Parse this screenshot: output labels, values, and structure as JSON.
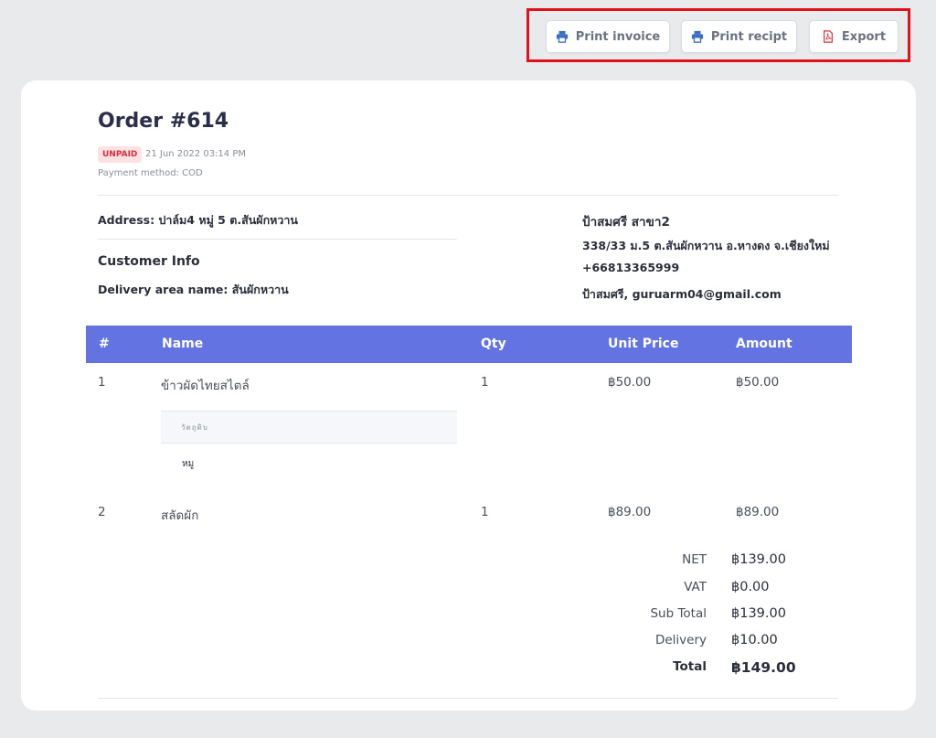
{
  "toolbar": {
    "print_invoice": "Print invoice",
    "print_receipt": "Print recipt",
    "export": "Export",
    "accent_color": "#3b6fc4",
    "export_icon_color": "#d9363e",
    "highlight_color": "#e3101a"
  },
  "order": {
    "title": "Order #614",
    "status": "UNPAID",
    "date": "21 Jun 2022 03:14 PM",
    "payment_method": "Payment method: COD"
  },
  "customer": {
    "address": "Address: ปาล์ม4 หมู่ 5 ต.สันผักหวาน",
    "info_title": "Customer Info",
    "delivery_area": "Delivery area name: สันผักหวาน"
  },
  "shop": {
    "name": "ป้าสมศรี สาขา2",
    "address": "338/33 ม.5 ต.สันผักหวาน อ.หางดง จ.เชียงใหม่",
    "phone": "+66813365999",
    "contact": "ป้าสมศรี, guruarm04@gmail.com"
  },
  "table": {
    "headers": [
      "#",
      "Name",
      "Qty",
      "Unit Price",
      "Amount"
    ],
    "header_color": "#6374e2",
    "rows": [
      {
        "no": "1",
        "name": "ข้าวผัดไทยสไตล์",
        "qty": "1",
        "unit_price": "฿50.00",
        "amount": "฿50.00",
        "sub_header": "วัตถุดิบ",
        "sub_item": "หมู"
      },
      {
        "no": "2",
        "name": "สลัดผัก",
        "qty": "1",
        "unit_price": "฿89.00",
        "amount": "฿89.00"
      }
    ]
  },
  "totals": [
    {
      "label": "NET",
      "value": "฿139.00"
    },
    {
      "label": "VAT",
      "value": "฿0.00"
    },
    {
      "label": "Sub Total",
      "value": "฿139.00"
    },
    {
      "label": "Delivery",
      "value": "฿10.00"
    },
    {
      "label": "Total",
      "value": "฿149.00"
    }
  ]
}
